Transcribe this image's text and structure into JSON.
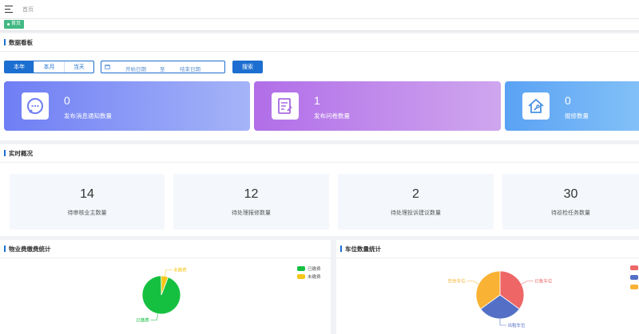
{
  "breadcrumb": "首页",
  "tag": "首页",
  "dashboard": {
    "title": "数据看板",
    "periods": [
      "本年",
      "本月",
      "当天"
    ],
    "date_start_placeholder": "开始日期",
    "date_separator": "至",
    "date_end_placeholder": "结束日期",
    "search_label": "搜索",
    "cards": [
      {
        "value": "0",
        "label": "发布消息通知数量",
        "icon": "chat-icon"
      },
      {
        "value": "1",
        "label": "发布问卷数量",
        "icon": "survey-icon"
      },
      {
        "value": "0",
        "label": "报修数量",
        "icon": "house-wrench-icon"
      }
    ]
  },
  "realtime": {
    "title": "实时概况",
    "stats": [
      {
        "value": "14",
        "label": "待审核业主数量"
      },
      {
        "value": "12",
        "label": "待处理报修数量"
      },
      {
        "value": "2",
        "label": "待处理投诉建议数量"
      },
      {
        "value": "30",
        "label": "待巡检任务数量"
      }
    ]
  },
  "fee_panel": {
    "title": "物业费缴费统计"
  },
  "parking_panel": {
    "title": "车位数量统计"
  },
  "chart_data": [
    {
      "type": "pie",
      "slices": [
        {
          "name": "已缴费",
          "value": 94,
          "color": "#15c040"
        },
        {
          "name": "未缴费",
          "value": 6,
          "color": "#f6c71a"
        }
      ],
      "legend_position": "top-right"
    },
    {
      "type": "pie",
      "slices": [
        {
          "name": "已售车位",
          "value": 35,
          "color": "#ee6666"
        },
        {
          "name": "出租车位",
          "value": 30,
          "color": "#5470c6"
        },
        {
          "name": "空余车位",
          "value": 35,
          "color": "#f9b233"
        }
      ],
      "legend_position": "top-right"
    }
  ]
}
